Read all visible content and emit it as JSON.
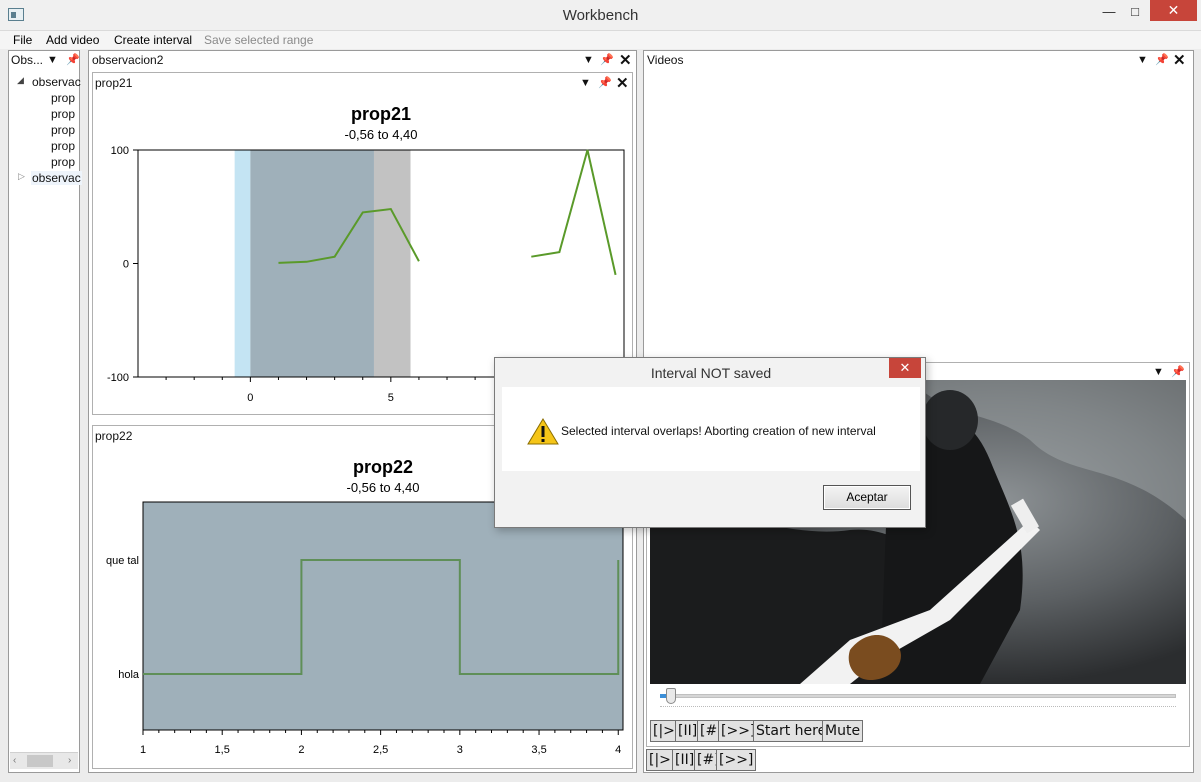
{
  "window": {
    "title": "Workbench"
  },
  "menu": {
    "file": "File",
    "add_video": "Add video",
    "create_interval": "Create interval",
    "save_range": "Save selected range"
  },
  "left_panel": {
    "title": "Obs...",
    "tree": [
      {
        "label": "observac",
        "expanded": true
      },
      {
        "label": "prop"
      },
      {
        "label": "prop"
      },
      {
        "label": "prop"
      },
      {
        "label": "prop"
      },
      {
        "label": "prop"
      },
      {
        "label": "observac",
        "expanded": false,
        "selected": true
      }
    ]
  },
  "doc_panel": {
    "title": "observacion2"
  },
  "chart1": {
    "panel_title": "prop21",
    "chart_data": {
      "type": "line",
      "title": "prop21",
      "subtitle": "-0,56 to 4,40",
      "y_ticks": [
        "100",
        "0",
        "-100"
      ],
      "x_ticks": [
        "0",
        "5"
      ],
      "xlim": [
        -4,
        13.3
      ],
      "ylim": [
        -100,
        100
      ],
      "series": [
        {
          "color": "#5a9a2a",
          "points": [
            [
              1,
              0.5
            ],
            [
              2,
              1.5
            ],
            [
              3,
              6
            ],
            [
              4,
              45
            ],
            [
              5,
              48
            ],
            [
              6,
              2
            ]
          ]
        },
        {
          "color": "#5a9a2a",
          "points": [
            [
              10,
              6
            ],
            [
              11,
              10
            ],
            [
              12,
              100
            ],
            [
              13,
              -10
            ]
          ]
        }
      ],
      "regions": [
        {
          "from": -0.56,
          "to": 0,
          "color": "#c4e4f3"
        },
        {
          "from": 0,
          "to": 4.4,
          "color": "#9fb0ba"
        },
        {
          "from": 4.4,
          "to": 5.7,
          "color": "#c2c2c2"
        }
      ]
    }
  },
  "chart2": {
    "panel_title": "prop22",
    "chart_data": {
      "type": "line",
      "title": "prop22",
      "subtitle": "-0,56 to 4,40",
      "y_categories": [
        "que tal",
        "hola"
      ],
      "x_ticks": [
        "1",
        "1,5",
        "2",
        "2,5",
        "3",
        "3,5",
        "4"
      ],
      "xlim": [
        1,
        4.03
      ],
      "step_series": {
        "color": "#5f8f58",
        "points": [
          [
            1,
            "hola"
          ],
          [
            2,
            "hola"
          ],
          [
            2,
            "que tal"
          ],
          [
            3,
            "que tal"
          ],
          [
            3,
            "hola"
          ],
          [
            4,
            "hola"
          ],
          [
            4,
            "que tal"
          ]
        ]
      },
      "background": "#9fb0ba"
    }
  },
  "videos_panel": {
    "title": "Videos"
  },
  "video_controls": {
    "row1": [
      "[|>]",
      "[II]",
      "[#]",
      "[>>]",
      "Start here",
      "Mute"
    ],
    "row2": [
      "[|>]",
      "[II]",
      "[#]",
      "[>>]"
    ]
  },
  "dialog": {
    "title": "Interval NOT saved",
    "message": "Selected interval overlaps! Aborting creation of new interval",
    "ok_label": "Aceptar"
  }
}
